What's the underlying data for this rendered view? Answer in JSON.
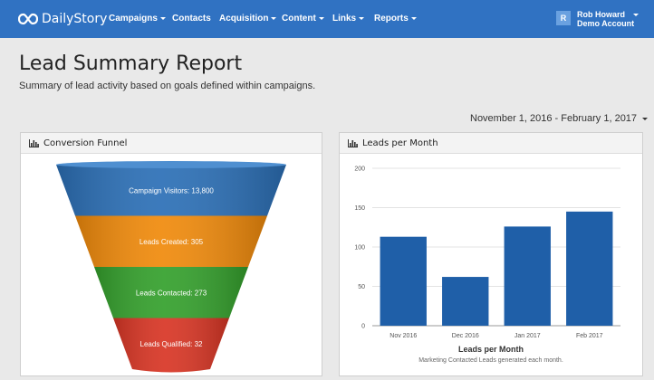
{
  "navbar": {
    "brand": "DailyStory",
    "items": [
      {
        "label": "Campaigns",
        "dropdown": true
      },
      {
        "label": "Contacts",
        "dropdown": false
      },
      {
        "label": "Acquisition",
        "dropdown": true
      },
      {
        "label": "Content",
        "dropdown": true
      },
      {
        "label": "Links",
        "dropdown": true
      },
      {
        "label": "Reports",
        "dropdown": true
      }
    ],
    "user": {
      "initial": "R",
      "name": "Rob Howard",
      "account": "Demo Account"
    }
  },
  "page": {
    "title": "Lead Summary Report",
    "subtitle": "Summary of lead activity based on goals defined within campaigns.",
    "date_range": "November 1, 2016 - February 1, 2017"
  },
  "funnel_panel": {
    "title": "Conversion Funnel",
    "stages": [
      {
        "label": "Campaign Visitors: 13,800",
        "color": "#2b6fb6"
      },
      {
        "label": "Leads Created: 305",
        "color": "#f08a0b"
      },
      {
        "label": "Leads Contacted: 273",
        "color": "#34a02c"
      },
      {
        "label": "Leads Qualified: 32",
        "color": "#d83524"
      }
    ]
  },
  "leads_panel": {
    "title": "Leads per Month"
  },
  "chart_data": {
    "type": "bar",
    "categories": [
      "Nov 2016",
      "Dec 2016",
      "Jan 2017",
      "Feb 2017"
    ],
    "values": [
      113,
      62,
      126,
      145
    ],
    "title": "Leads per Month",
    "subtitle": "Marketing Contacted Leads generated each month.",
    "ylim": [
      0,
      200
    ],
    "yticks": [
      0,
      50,
      100,
      150,
      200
    ],
    "grid": true,
    "bar_color": "#1f5fa8"
  },
  "colors": {
    "navbar": "#3072c2",
    "background": "#e9e9e9"
  }
}
